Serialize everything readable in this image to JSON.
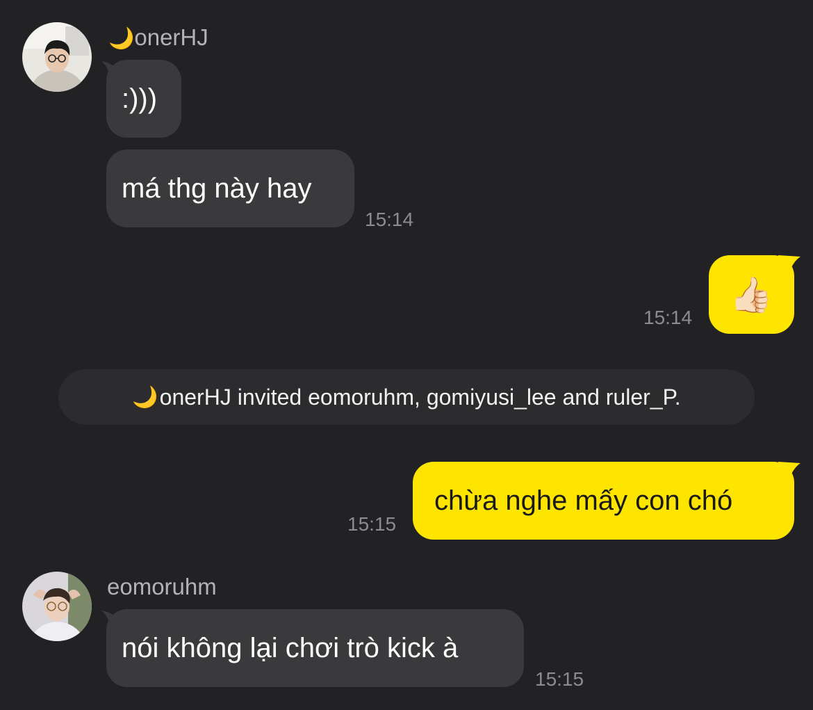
{
  "messages": {
    "sender1": {
      "moon": "🌙",
      "name": "onerHJ",
      "bubble1": ":)))",
      "bubble2": "má thg này hay",
      "time": "15:14"
    },
    "out1": {
      "emoji": "👍🏻",
      "time": "15:14"
    },
    "system": {
      "moon": "🌙",
      "text": "onerHJ invited eomoruhm, gomiyusi_lee and ruler_P."
    },
    "out2": {
      "text": "chừa nghe mấy con chó",
      "time": "15:15"
    },
    "sender2": {
      "name": "eomoruhm",
      "bubble1": "nói không lại chơi trò kick à",
      "time": "15:15"
    }
  },
  "colors": {
    "background": "#222224",
    "incoming_bubble": "#3a3a3d",
    "outgoing_bubble": "#fee500",
    "system_pill": "#2c2c2f"
  }
}
